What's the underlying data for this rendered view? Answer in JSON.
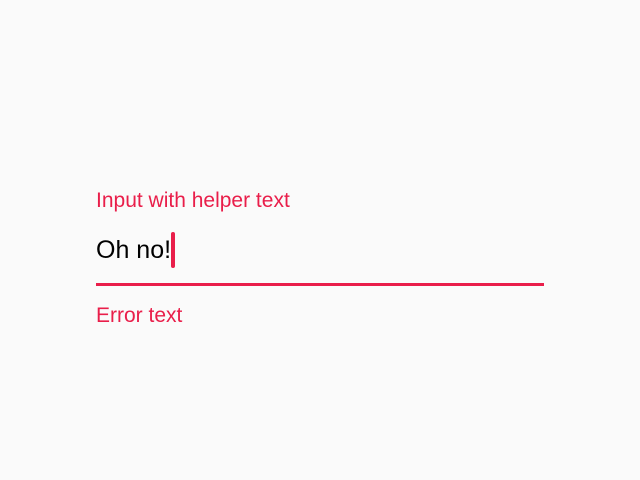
{
  "colors": {
    "error": "#e91e4a",
    "text": "#000000",
    "background": "#fafafa"
  },
  "field": {
    "label": "Input with helper text",
    "value": "Oh no!",
    "helper_text": "Error text"
  }
}
